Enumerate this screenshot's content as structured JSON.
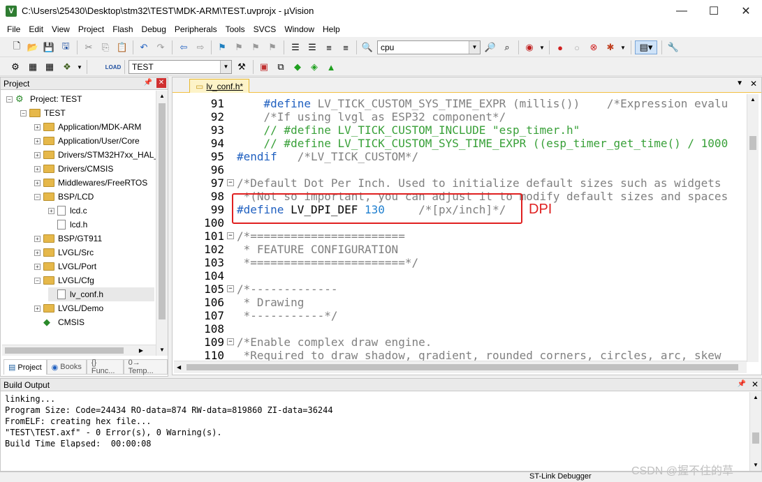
{
  "window": {
    "title": "C:\\Users\\25430\\Desktop\\stm32\\TEST\\MDK-ARM\\TEST.uvprojx - µVision",
    "minimize": "—",
    "maximize": "☐",
    "close": "✕"
  },
  "menu": [
    "File",
    "Edit",
    "View",
    "Project",
    "Flash",
    "Debug",
    "Peripherals",
    "Tools",
    "SVCS",
    "Window",
    "Help"
  ],
  "toolbar1": {
    "find_combo": "cpu"
  },
  "toolbar2": {
    "target_combo": "TEST"
  },
  "project_panel": {
    "title": "Project",
    "pin": "📌",
    "close": "✕",
    "tree": [
      {
        "label": "Project: TEST",
        "kind": "root"
      },
      {
        "label": "TEST",
        "kind": "target"
      },
      {
        "label": "Application/MDK-ARM",
        "kind": "folder"
      },
      {
        "label": "Application/User/Core",
        "kind": "folder"
      },
      {
        "label": "Drivers/STM32H7xx_HAL_",
        "kind": "folder"
      },
      {
        "label": "Drivers/CMSIS",
        "kind": "folder"
      },
      {
        "label": "Middlewares/FreeRTOS",
        "kind": "folder"
      },
      {
        "label": "BSP/LCD",
        "kind": "folder-open"
      },
      {
        "label": "lcd.c",
        "kind": "file"
      },
      {
        "label": "lcd.h",
        "kind": "file"
      },
      {
        "label": "BSP/GT911",
        "kind": "folder"
      },
      {
        "label": "LVGL/Src",
        "kind": "folder"
      },
      {
        "label": "LVGL/Port",
        "kind": "folder"
      },
      {
        "label": "LVGL/Cfg",
        "kind": "folder-open"
      },
      {
        "label": "lv_conf.h",
        "kind": "file"
      },
      {
        "label": "LVGL/Demo",
        "kind": "folder"
      },
      {
        "label": "CMSIS",
        "kind": "component"
      }
    ],
    "tabs": [
      "Project",
      "Books",
      "{} Func...",
      "0→ Temp..."
    ]
  },
  "editor": {
    "tab_label": "lv_conf.h*",
    "lines": [
      {
        "n": "91",
        "fold": "",
        "parts": [
          {
            "t": "    #define ",
            "c": "c-pp"
          },
          {
            "t": "LV_TICK_CUSTOM_SYS_TIME_EXPR (millis())    ",
            "c": "c-cm"
          },
          {
            "t": "/*Expression evalu",
            "c": "c-cm"
          }
        ]
      },
      {
        "n": "92",
        "fold": "",
        "parts": [
          {
            "t": "    /*If using lvgl as ESP32 component*/",
            "c": "c-cm"
          }
        ]
      },
      {
        "n": "93",
        "fold": "",
        "parts": [
          {
            "t": "    // #define LV_TICK_CUSTOM_INCLUDE \"esp_timer.h\"",
            "c": "c-gr"
          }
        ]
      },
      {
        "n": "94",
        "fold": "",
        "parts": [
          {
            "t": "    // #define LV_TICK_CUSTOM_SYS_TIME_EXPR ((esp_timer_get_time() / 1000",
            "c": "c-gr"
          }
        ]
      },
      {
        "n": "95",
        "fold": "",
        "parts": [
          {
            "t": "#endif",
            "c": "c-pp"
          },
          {
            "t": "   /*LV_TICK_CUSTOM*/",
            "c": "c-cm"
          }
        ]
      },
      {
        "n": "96",
        "fold": "",
        "parts": []
      },
      {
        "n": "97",
        "fold": "−",
        "parts": [
          {
            "t": "/*Default Dot Per Inch. Used to initialize default sizes such as widgets",
            "c": "c-cm"
          }
        ]
      },
      {
        "n": "98",
        "fold": "",
        "parts": [
          {
            "t": " *(Not so important, you can adjust it to modify default sizes and spaces",
            "c": "c-cm"
          }
        ]
      },
      {
        "n": "99",
        "fold": "",
        "parts": [
          {
            "t": "#define ",
            "c": "c-pp"
          },
          {
            "t": "LV_DPI_DEF ",
            "c": "c-tx"
          },
          {
            "t": "130",
            "c": "c-nm"
          },
          {
            "t": "     /*[px/inch]*/",
            "c": "c-cm"
          }
        ]
      },
      {
        "n": "100",
        "fold": "",
        "parts": []
      },
      {
        "n": "101",
        "fold": "−",
        "parts": [
          {
            "t": "/*=======================",
            "c": "c-cm"
          }
        ]
      },
      {
        "n": "102",
        "fold": "",
        "parts": [
          {
            "t": " * FEATURE CONFIGURATION",
            "c": "c-cm"
          }
        ]
      },
      {
        "n": "103",
        "fold": "",
        "parts": [
          {
            "t": " *=======================*/",
            "c": "c-cm"
          }
        ]
      },
      {
        "n": "104",
        "fold": "",
        "parts": []
      },
      {
        "n": "105",
        "fold": "−",
        "parts": [
          {
            "t": "/*-------------",
            "c": "c-cm"
          }
        ]
      },
      {
        "n": "106",
        "fold": "",
        "parts": [
          {
            "t": " * Drawing",
            "c": "c-cm"
          }
        ]
      },
      {
        "n": "107",
        "fold": "",
        "parts": [
          {
            "t": " *-----------*/",
            "c": "c-cm"
          }
        ]
      },
      {
        "n": "108",
        "fold": "",
        "parts": []
      },
      {
        "n": "109",
        "fold": "−",
        "parts": [
          {
            "t": "/*Enable complex draw engine.",
            "c": "c-cm"
          }
        ]
      },
      {
        "n": "110",
        "fold": "",
        "parts": [
          {
            "t": " *Required to draw shadow, gradient, rounded corners, circles, arc, skew",
            "c": "c-cm"
          }
        ]
      }
    ],
    "annotation": "DPI"
  },
  "build_output": {
    "title": "Build Output",
    "lines": [
      "linking...",
      "Program Size: Code=24434 RO-data=874 RW-data=819860 ZI-data=36244",
      "FromELF: creating hex file...",
      "\"TEST\\TEST.axf\" - 0 Error(s), 0 Warning(s).",
      "Build Time Elapsed:  00:00:08"
    ]
  },
  "status": {
    "debugger": "ST-Link Debugger",
    "watermark": "CSDN @握不住的草"
  }
}
